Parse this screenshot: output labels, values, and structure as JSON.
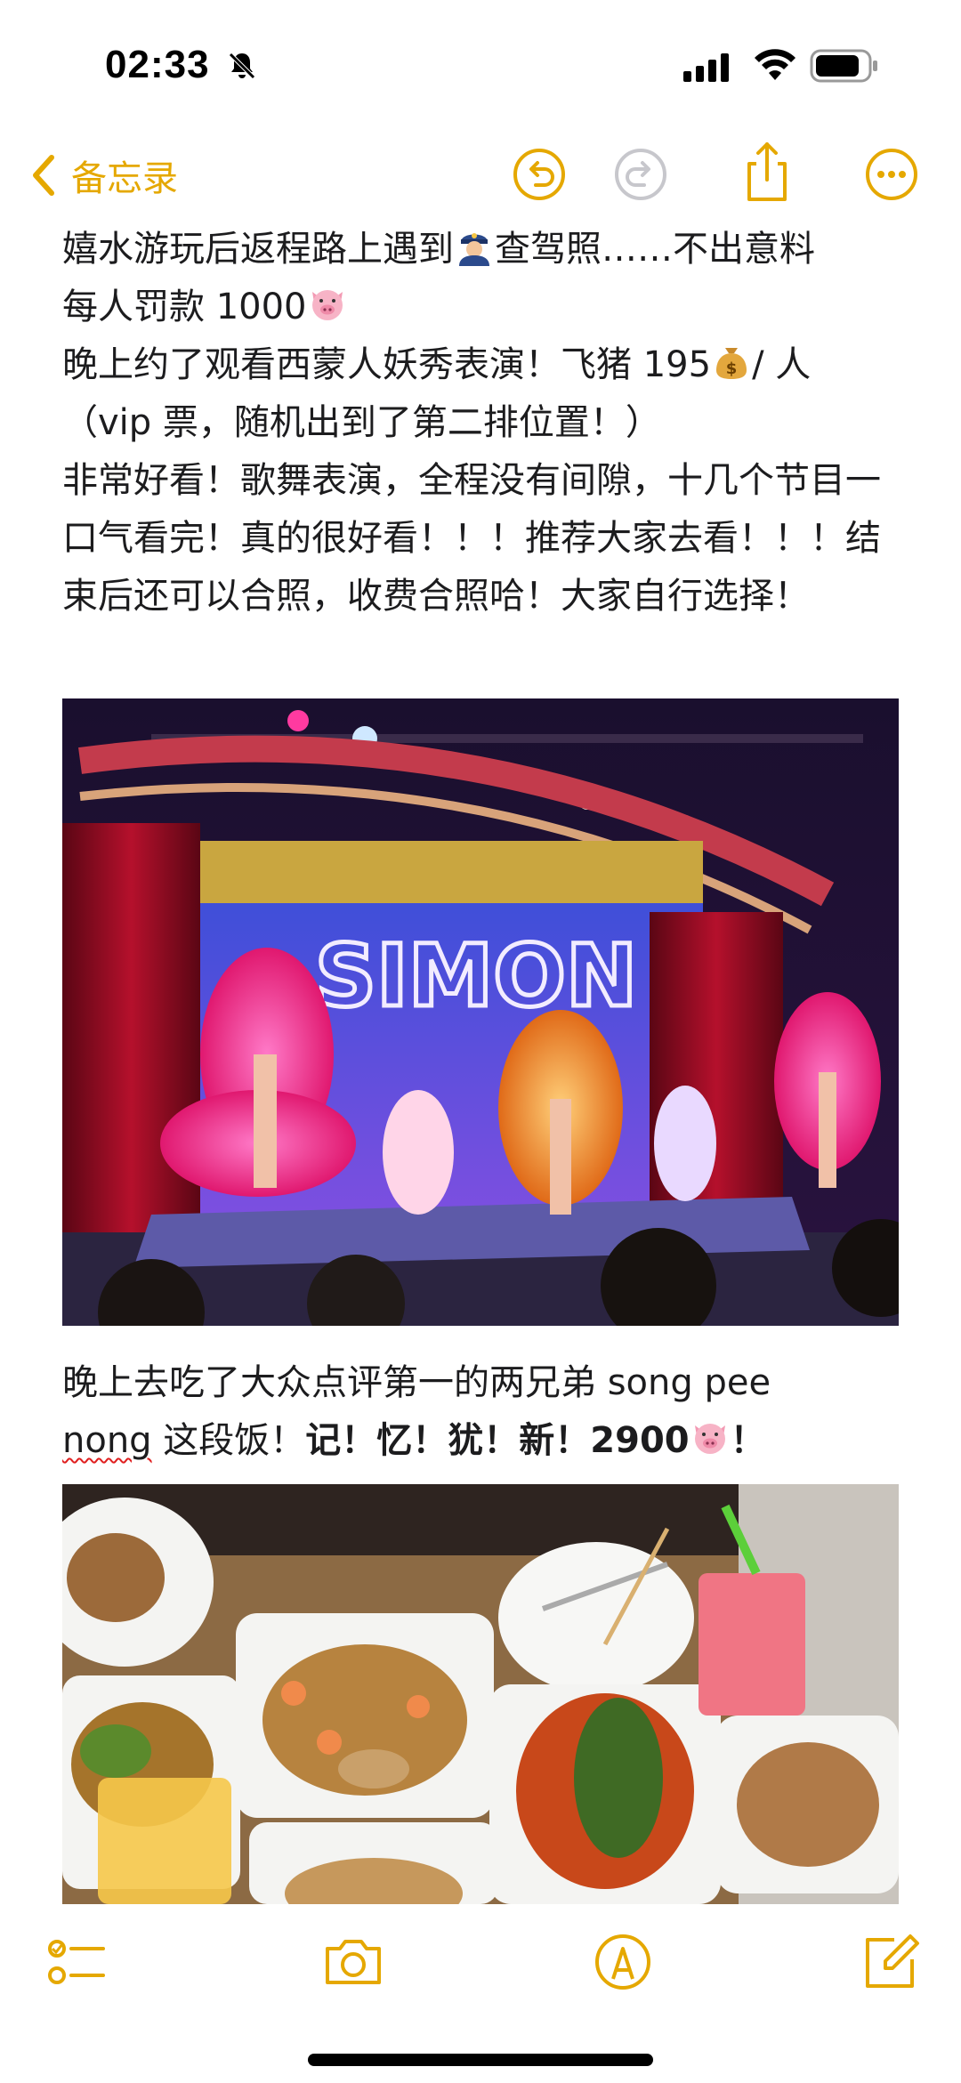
{
  "status_bar": {
    "time": "02:33",
    "mute_icon": "bell-slash-icon",
    "signal_icon": "cellular-signal-icon",
    "wifi_icon": "wifi-icon",
    "battery_icon": "battery-icon"
  },
  "nav": {
    "back_label": "备忘录",
    "back_icon": "chevron-left-icon",
    "undo_icon": "undo-icon",
    "redo_icon": "redo-icon",
    "share_icon": "share-icon",
    "more_icon": "more-icon",
    "accent_color": "#e5a800"
  },
  "note": {
    "para1_a": "嬉水游玩后返程路上遇到",
    "para1_emoji1": "police-officer-emoji",
    "para1_b": "查驾照……不出意料",
    "para2_a": "每人罚款 1000",
    "para2_emoji": "pig-face-emoji",
    "para3_a": "晚上约了观看西蒙人妖秀表演！飞猪 195",
    "para3_emoji": "money-bag-emoji",
    "para3_b": "/ 人",
    "para4": "（vip 票，随机出到了第二排位置！）",
    "para5": "非常好看！歌舞表演，全程没有间隙，十几个节目一口气看完！真的很好看！！！推荐大家去看！！！结束后还可以合照，收费合照哈！大家自行选择！",
    "para6_a": "晚上去吃了大众点评第一的两兄弟 song pee",
    "para7_misspelled": "nong",
    "para7_a": " 这段饭！",
    "para7_bold": "记！忆！犹！新！2900",
    "para7_emoji": "pig-face-emoji",
    "para7_tail": "！",
    "photo1": "SIMON",
    "photo1_desc_icon": "stage-show-photo",
    "photo2_desc_icon": "thai-food-table-photo"
  },
  "toolbar": {
    "checklist_icon": "checklist-icon",
    "camera_icon": "camera-icon",
    "markup_icon": "pen-markup-icon",
    "compose_icon": "compose-icon"
  }
}
